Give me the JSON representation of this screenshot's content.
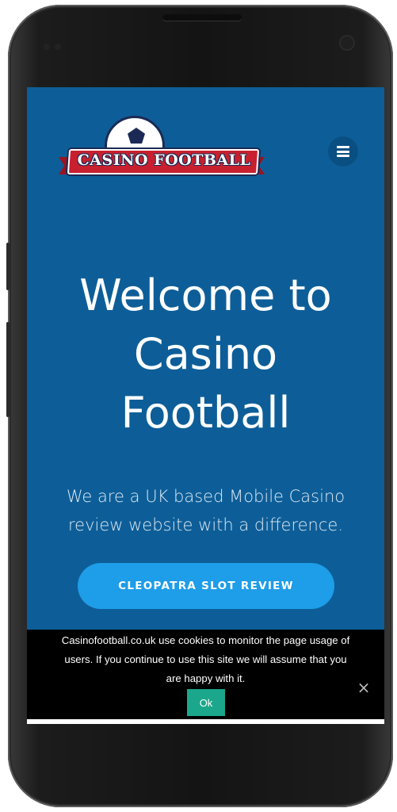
{
  "header": {
    "logo_text": "CASINO FOOTBALL",
    "menu_icon": "hamburger-menu-icon"
  },
  "hero": {
    "title_lines": [
      "Welcome to",
      "Casino",
      "Football"
    ],
    "subtitle_lines": [
      "We are a UK based Mobile Casino",
      "review website with a difference."
    ],
    "cta_label": "CLEOPATRA SLOT REVIEW"
  },
  "cookie_notice": {
    "text_lines": [
      "Casinofootball.co.uk use cookies to monitor the page usage of",
      "users. If you continue to use this site we will assume that you",
      "are happy with it."
    ],
    "ok_label": "Ok",
    "close_symbol": "×"
  },
  "colors": {
    "background": "#0d5e98",
    "cta": "#1e9de8",
    "ok_button": "#1ba78b",
    "logo_red": "#c8202f",
    "logo_navy": "#1b2a55"
  }
}
